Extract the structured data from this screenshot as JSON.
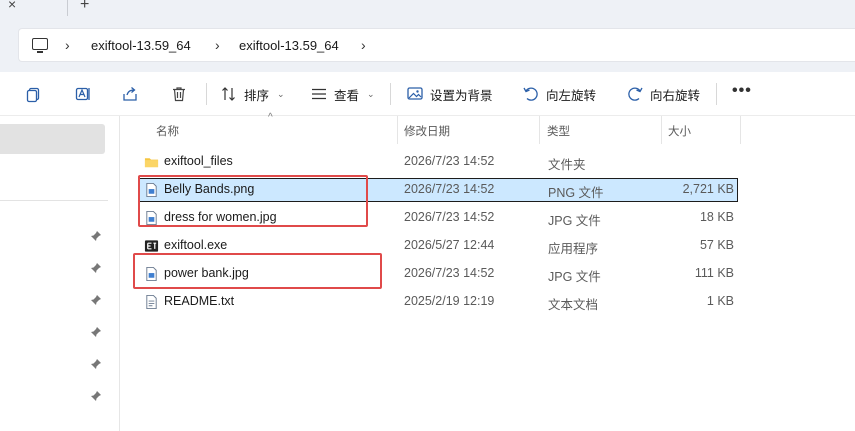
{
  "tabstrip": {
    "close_glyph": "×",
    "new_glyph": "+"
  },
  "address": {
    "icon": "pc-icon",
    "separator": "›",
    "crumbs": [
      "exiftool-13.59_64",
      "exiftool-13.59_64"
    ]
  },
  "toolbar": {
    "sort_label": "排序",
    "view_label": "查看",
    "set_background_label": "设置为背景",
    "rotate_left_label": "向左旋转",
    "rotate_right_label": "向右旋转",
    "more_glyph": "•••",
    "dropdown_glyph": "⌄"
  },
  "columns": {
    "name": "名称",
    "modified": "修改日期",
    "type": "类型",
    "size": "大小"
  },
  "files": [
    {
      "icon": "folder-icon",
      "name": "exiftool_files",
      "modified": "2026/7/23 14:52",
      "type": "文件夹",
      "size": ""
    },
    {
      "icon": "image-file-icon",
      "name": "Belly Bands.png",
      "modified": "2026/7/23 14:52",
      "type": "PNG 文件",
      "size": "2,721 KB"
    },
    {
      "icon": "image-file-icon",
      "name": "dress for women.jpg",
      "modified": "2026/7/23 14:52",
      "type": "JPG 文件",
      "size": "18 KB"
    },
    {
      "icon": "exe-file-icon",
      "name": "exiftool.exe",
      "modified": "2026/5/27 12:44",
      "type": "应用程序",
      "size": "57 KB"
    },
    {
      "icon": "image-file-icon",
      "name": "power bank.jpg",
      "modified": "2026/7/23 14:52",
      "type": "JPG 文件",
      "size": "111 KB"
    },
    {
      "icon": "text-file-icon",
      "name": "README.txt",
      "modified": "2025/2/19 12:19",
      "type": "文本文档",
      "size": "1 KB"
    }
  ],
  "colors": {
    "selection_bg": "#cce8ff",
    "highlight_red": "#e04a4a",
    "folder_yellow": "#f5c542"
  }
}
